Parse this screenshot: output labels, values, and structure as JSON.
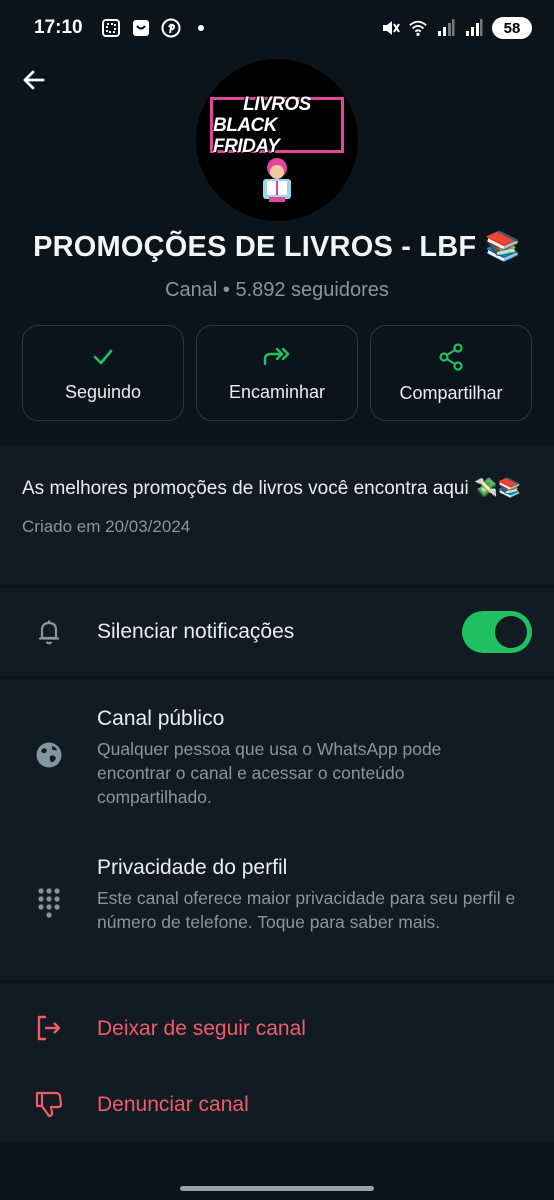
{
  "status_bar": {
    "time": "17:10",
    "battery": "58",
    "left_icons": [
      "screenshot-icon",
      "app-notification-icon",
      "pinterest-icon",
      "dot-icon"
    ],
    "right_icons": [
      "mute-icon",
      "wifi-icon",
      "signal-icon",
      "signal-icon"
    ]
  },
  "header": {
    "back_icon": "arrow-left-icon"
  },
  "avatar": {
    "line1": "LIVROS",
    "line2": "BLACK FRIDAY",
    "frame_color": "#e0479c"
  },
  "channel": {
    "title": "PROMOÇÕES DE LIVROS - LBF 📚",
    "subtitle": "Canal • 5.892 seguidores"
  },
  "actions": [
    {
      "label": "Seguindo",
      "icon": "check-icon"
    },
    {
      "label": "Encaminhar",
      "icon": "forward-icon"
    },
    {
      "label": "Compartilhar",
      "icon": "share-icon"
    }
  ],
  "description": {
    "text": "As melhores promoções de livros você encontra aqui 💸📚",
    "created": "Criado em 20/03/2024"
  },
  "notifications": {
    "label": "Silenciar notificações",
    "toggle_on": true,
    "icon": "bell-icon"
  },
  "info_rows": [
    {
      "title": "Canal público",
      "text": "Qualquer pessoa que usa o WhatsApp pode encontrar o canal e acessar o conteúdo compartilhado.",
      "icon": "globe-icon"
    },
    {
      "title": "Privacidade do perfil",
      "text": "Este canal oferece maior privacidade para seu perfil e número de telefone. Toque para saber mais.",
      "icon": "dialpad-icon"
    }
  ],
  "danger_rows": [
    {
      "label": "Deixar de seguir canal",
      "icon": "exit-icon"
    },
    {
      "label": "Denunciar canal",
      "icon": "thumbs-down-icon"
    }
  ],
  "colors": {
    "background": "#0b141a",
    "section": "#111b21",
    "accent": "#21c063",
    "danger": "#f15c6d",
    "muted": "#8696a0"
  }
}
